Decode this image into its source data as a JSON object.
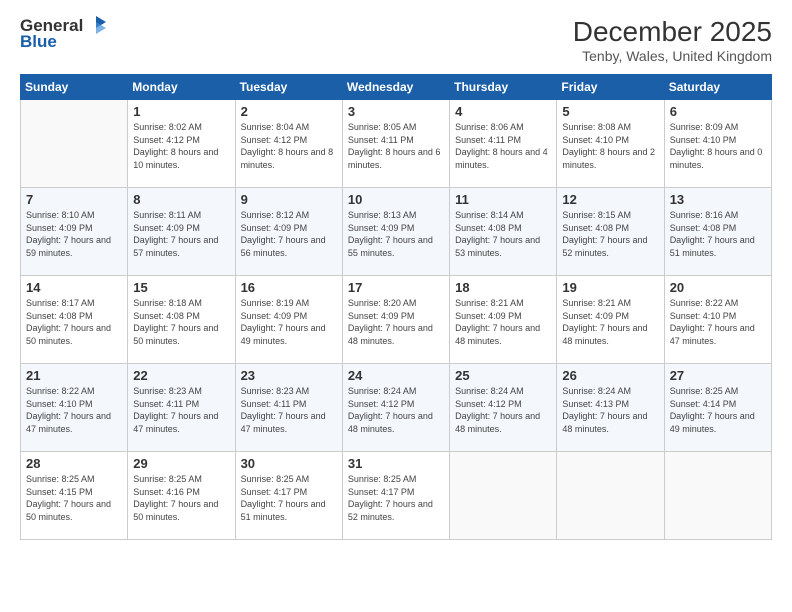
{
  "logo": {
    "general": "General",
    "blue": "Blue"
  },
  "calendar": {
    "title": "December 2025",
    "subtitle": "Tenby, Wales, United Kingdom"
  },
  "headers": [
    "Sunday",
    "Monday",
    "Tuesday",
    "Wednesday",
    "Thursday",
    "Friday",
    "Saturday"
  ],
  "rows": [
    [
      {
        "empty": true
      },
      {
        "day": "1",
        "sunrise": "Sunrise: 8:02 AM",
        "sunset": "Sunset: 4:12 PM",
        "daylight": "Daylight: 8 hours and 10 minutes."
      },
      {
        "day": "2",
        "sunrise": "Sunrise: 8:04 AM",
        "sunset": "Sunset: 4:12 PM",
        "daylight": "Daylight: 8 hours and 8 minutes."
      },
      {
        "day": "3",
        "sunrise": "Sunrise: 8:05 AM",
        "sunset": "Sunset: 4:11 PM",
        "daylight": "Daylight: 8 hours and 6 minutes."
      },
      {
        "day": "4",
        "sunrise": "Sunrise: 8:06 AM",
        "sunset": "Sunset: 4:11 PM",
        "daylight": "Daylight: 8 hours and 4 minutes."
      },
      {
        "day": "5",
        "sunrise": "Sunrise: 8:08 AM",
        "sunset": "Sunset: 4:10 PM",
        "daylight": "Daylight: 8 hours and 2 minutes."
      },
      {
        "day": "6",
        "sunrise": "Sunrise: 8:09 AM",
        "sunset": "Sunset: 4:10 PM",
        "daylight": "Daylight: 8 hours and 0 minutes."
      }
    ],
    [
      {
        "day": "7",
        "sunrise": "Sunrise: 8:10 AM",
        "sunset": "Sunset: 4:09 PM",
        "daylight": "Daylight: 7 hours and 59 minutes."
      },
      {
        "day": "8",
        "sunrise": "Sunrise: 8:11 AM",
        "sunset": "Sunset: 4:09 PM",
        "daylight": "Daylight: 7 hours and 57 minutes."
      },
      {
        "day": "9",
        "sunrise": "Sunrise: 8:12 AM",
        "sunset": "Sunset: 4:09 PM",
        "daylight": "Daylight: 7 hours and 56 minutes."
      },
      {
        "day": "10",
        "sunrise": "Sunrise: 8:13 AM",
        "sunset": "Sunset: 4:09 PM",
        "daylight": "Daylight: 7 hours and 55 minutes."
      },
      {
        "day": "11",
        "sunrise": "Sunrise: 8:14 AM",
        "sunset": "Sunset: 4:08 PM",
        "daylight": "Daylight: 7 hours and 53 minutes."
      },
      {
        "day": "12",
        "sunrise": "Sunrise: 8:15 AM",
        "sunset": "Sunset: 4:08 PM",
        "daylight": "Daylight: 7 hours and 52 minutes."
      },
      {
        "day": "13",
        "sunrise": "Sunrise: 8:16 AM",
        "sunset": "Sunset: 4:08 PM",
        "daylight": "Daylight: 7 hours and 51 minutes."
      }
    ],
    [
      {
        "day": "14",
        "sunrise": "Sunrise: 8:17 AM",
        "sunset": "Sunset: 4:08 PM",
        "daylight": "Daylight: 7 hours and 50 minutes."
      },
      {
        "day": "15",
        "sunrise": "Sunrise: 8:18 AM",
        "sunset": "Sunset: 4:08 PM",
        "daylight": "Daylight: 7 hours and 50 minutes."
      },
      {
        "day": "16",
        "sunrise": "Sunrise: 8:19 AM",
        "sunset": "Sunset: 4:09 PM",
        "daylight": "Daylight: 7 hours and 49 minutes."
      },
      {
        "day": "17",
        "sunrise": "Sunrise: 8:20 AM",
        "sunset": "Sunset: 4:09 PM",
        "daylight": "Daylight: 7 hours and 48 minutes."
      },
      {
        "day": "18",
        "sunrise": "Sunrise: 8:21 AM",
        "sunset": "Sunset: 4:09 PM",
        "daylight": "Daylight: 7 hours and 48 minutes."
      },
      {
        "day": "19",
        "sunrise": "Sunrise: 8:21 AM",
        "sunset": "Sunset: 4:09 PM",
        "daylight": "Daylight: 7 hours and 48 minutes."
      },
      {
        "day": "20",
        "sunrise": "Sunrise: 8:22 AM",
        "sunset": "Sunset: 4:10 PM",
        "daylight": "Daylight: 7 hours and 47 minutes."
      }
    ],
    [
      {
        "day": "21",
        "sunrise": "Sunrise: 8:22 AM",
        "sunset": "Sunset: 4:10 PM",
        "daylight": "Daylight: 7 hours and 47 minutes."
      },
      {
        "day": "22",
        "sunrise": "Sunrise: 8:23 AM",
        "sunset": "Sunset: 4:11 PM",
        "daylight": "Daylight: 7 hours and 47 minutes."
      },
      {
        "day": "23",
        "sunrise": "Sunrise: 8:23 AM",
        "sunset": "Sunset: 4:11 PM",
        "daylight": "Daylight: 7 hours and 47 minutes."
      },
      {
        "day": "24",
        "sunrise": "Sunrise: 8:24 AM",
        "sunset": "Sunset: 4:12 PM",
        "daylight": "Daylight: 7 hours and 48 minutes."
      },
      {
        "day": "25",
        "sunrise": "Sunrise: 8:24 AM",
        "sunset": "Sunset: 4:12 PM",
        "daylight": "Daylight: 7 hours and 48 minutes."
      },
      {
        "day": "26",
        "sunrise": "Sunrise: 8:24 AM",
        "sunset": "Sunset: 4:13 PM",
        "daylight": "Daylight: 7 hours and 48 minutes."
      },
      {
        "day": "27",
        "sunrise": "Sunrise: 8:25 AM",
        "sunset": "Sunset: 4:14 PM",
        "daylight": "Daylight: 7 hours and 49 minutes."
      }
    ],
    [
      {
        "day": "28",
        "sunrise": "Sunrise: 8:25 AM",
        "sunset": "Sunset: 4:15 PM",
        "daylight": "Daylight: 7 hours and 50 minutes."
      },
      {
        "day": "29",
        "sunrise": "Sunrise: 8:25 AM",
        "sunset": "Sunset: 4:16 PM",
        "daylight": "Daylight: 7 hours and 50 minutes."
      },
      {
        "day": "30",
        "sunrise": "Sunrise: 8:25 AM",
        "sunset": "Sunset: 4:17 PM",
        "daylight": "Daylight: 7 hours and 51 minutes."
      },
      {
        "day": "31",
        "sunrise": "Sunrise: 8:25 AM",
        "sunset": "Sunset: 4:17 PM",
        "daylight": "Daylight: 7 hours and 52 minutes."
      },
      {
        "empty": true
      },
      {
        "empty": true
      },
      {
        "empty": true
      }
    ]
  ]
}
